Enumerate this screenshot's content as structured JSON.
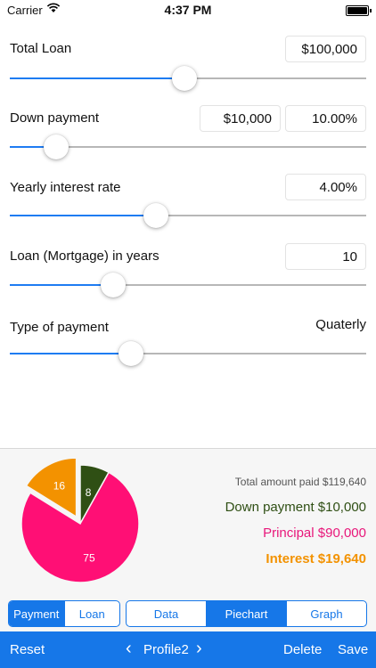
{
  "status_bar": {
    "carrier": "Carrier",
    "time": "4:37 PM",
    "wifi_icon": "wifi-icon",
    "battery_icon": "battery-icon"
  },
  "form": {
    "total_loan": {
      "label": "Total Loan",
      "value": "$100,000",
      "slider_fraction": 0.49
    },
    "down_payment": {
      "label": "Down payment",
      "amount": "$10,000",
      "percent": "10.00%",
      "slider_fraction": 0.13
    },
    "interest_rate": {
      "label": "Yearly interest rate",
      "value": "4.00%",
      "slider_fraction": 0.41
    },
    "years": {
      "label": "Loan (Mortgage) in years",
      "value": "10",
      "slider_fraction": 0.29
    },
    "payment_type": {
      "label": "Type of payment",
      "value": "Quaterly",
      "slider_fraction": 0.34
    }
  },
  "summary": {
    "total": "Total amount paid $119,640",
    "down": "Down payment $10,000",
    "principal": "Principal $90,000",
    "interest": "Interest $19,640"
  },
  "chart_data": {
    "type": "pie",
    "slices": [
      {
        "label": "8",
        "value": 8,
        "color": "#2f4f14"
      },
      {
        "label": "75",
        "value": 75,
        "color": "#ff0f75"
      },
      {
        "label": "16",
        "value": 16,
        "color": "#f39200",
        "exploded": true
      }
    ]
  },
  "segments_left": {
    "items": [
      "Payment",
      "Loan"
    ],
    "active": 0
  },
  "segments_right": {
    "items": [
      "Data",
      "Piechart",
      "Graph"
    ],
    "active": 1
  },
  "toolbar": {
    "reset": "Reset",
    "profile": "Profile2",
    "delete": "Delete",
    "save": "Save",
    "prev_icon": "chevron-left-icon",
    "next_icon": "chevron-right-icon"
  },
  "colors": {
    "accent": "#1677e8",
    "down": "#2f4f14",
    "principal": "#ff0f75",
    "interest": "#f39200"
  }
}
